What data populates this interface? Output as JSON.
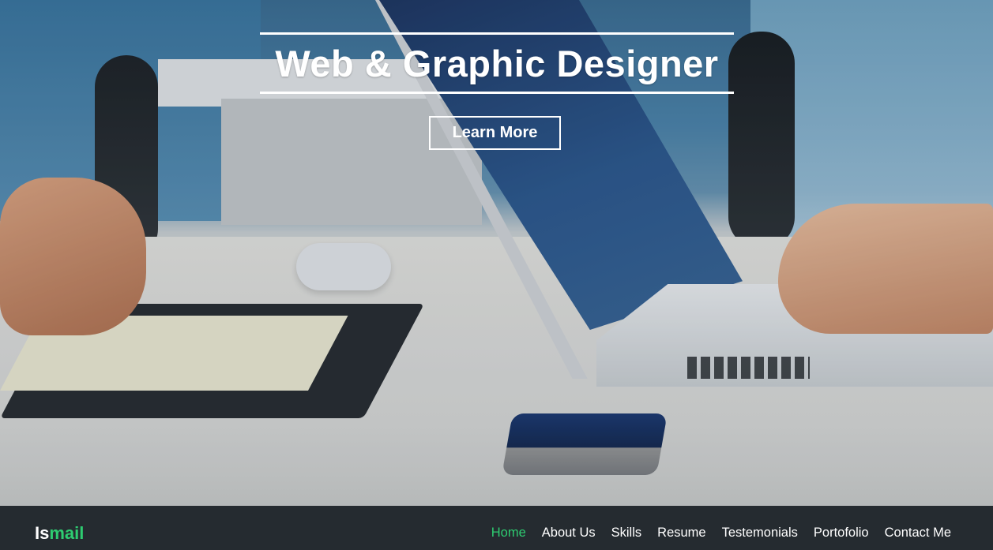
{
  "hero": {
    "headline": "Web & Graphic Designer",
    "cta_label": "Learn More",
    "background_image": "office desk with laptop photo"
  },
  "navbar": {
    "logo_part1": "Is",
    "logo_part2": "mail",
    "items": [
      {
        "label": "Home",
        "active": true
      },
      {
        "label": "About Us",
        "active": false
      },
      {
        "label": "Skills",
        "active": false
      },
      {
        "label": "Resume",
        "active": false
      },
      {
        "label": "Testemonials",
        "active": false
      },
      {
        "label": "Portofolio",
        "active": false
      },
      {
        "label": "Contact Me",
        "active": false
      }
    ]
  },
  "colors": {
    "accent": "#2ecc71",
    "navbar_bg": "#252b30",
    "text": "#ffffff"
  }
}
